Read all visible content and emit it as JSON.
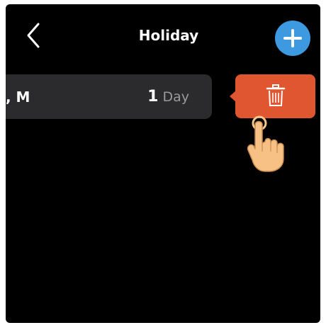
{
  "header": {
    "title": "Holiday",
    "back_icon": "chevron-left-icon",
    "add_icon": "plus-icon"
  },
  "holiday_row": {
    "label": ", M",
    "count": "1",
    "unit": "Day"
  },
  "delete_action": {
    "icon": "trash-icon"
  },
  "colors": {
    "background": "#000000",
    "add_button": "#3e9ae0",
    "delete_button": "#df5631",
    "row_background": "#2b2b2d",
    "muted_text": "#9a9a9a"
  }
}
